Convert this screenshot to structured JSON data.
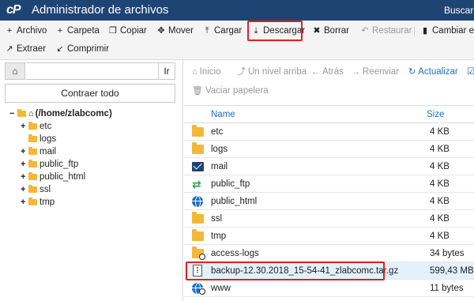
{
  "header": {
    "logo": "cP",
    "title": "Administrador de archivos",
    "search_label": "Buscar"
  },
  "toolbar": {
    "row1": [
      {
        "icon": "+",
        "label": "Archivo",
        "disabled": false
      },
      {
        "icon": "+",
        "label": "Carpeta",
        "disabled": false
      },
      {
        "icon": "❐",
        "label": "Copiar",
        "disabled": false
      },
      {
        "icon": "✥",
        "label": "Mover",
        "disabled": false
      },
      {
        "icon": "⤒",
        "label": "Cargar",
        "disabled": false
      },
      {
        "icon": "⤓",
        "label": "Descargar",
        "disabled": false
      },
      {
        "icon": "✖",
        "label": "Borrar",
        "disabled": false
      },
      {
        "icon": "↶",
        "label": "Restaurar",
        "disabled": true
      },
      {
        "icon": "▮",
        "label": "Cambiar el n",
        "disabled": false
      }
    ],
    "row2": [
      {
        "icon": "↗",
        "label": "Extraer"
      },
      {
        "icon": "↙",
        "label": "Comprimir"
      }
    ]
  },
  "left_panel": {
    "go_label": "Ir",
    "collapse_label": "Contraer todo",
    "tree": {
      "root_label": "(/home/zlabcomc)",
      "children": [
        {
          "label": "etc",
          "expandable": true
        },
        {
          "label": "logs",
          "expandable": false
        },
        {
          "label": "mail",
          "expandable": true
        },
        {
          "label": "public_ftp",
          "expandable": true
        },
        {
          "label": "public_html",
          "expandable": true
        },
        {
          "label": "ssl",
          "expandable": true
        },
        {
          "label": "tmp",
          "expandable": true
        }
      ]
    }
  },
  "nav": {
    "home": "Inicio",
    "up": "Un nivel arriba",
    "back": "Atrás",
    "forward": "Reenviar",
    "refresh": "Actualizar",
    "empty_trash": "Vaciar papelera"
  },
  "table": {
    "headers": {
      "name": "Name",
      "size": "Size"
    },
    "rows": [
      {
        "icon": "folder-icon",
        "name": "etc",
        "size": "4 KB"
      },
      {
        "icon": "folder-icon",
        "name": "logs",
        "size": "4 KB"
      },
      {
        "icon": "mail-icon",
        "name": "mail",
        "size": "4 KB"
      },
      {
        "icon": "share-icon",
        "name": "public_ftp",
        "size": "4 KB"
      },
      {
        "icon": "globe-icon",
        "name": "public_html",
        "size": "4 KB"
      },
      {
        "icon": "folder-icon",
        "name": "ssl",
        "size": "4 KB"
      },
      {
        "icon": "folder-icon",
        "name": "tmp",
        "size": "4 KB"
      },
      {
        "icon": "folder-link-icon",
        "name": "access-logs",
        "size": "34 bytes"
      },
      {
        "icon": "archive-icon",
        "name": "backup-12.30.2018_15-54-41_zlabcomc.tar.gz",
        "size": "599,43 MB"
      },
      {
        "icon": "globe-link-icon",
        "name": "www",
        "size": "11 bytes"
      }
    ]
  }
}
